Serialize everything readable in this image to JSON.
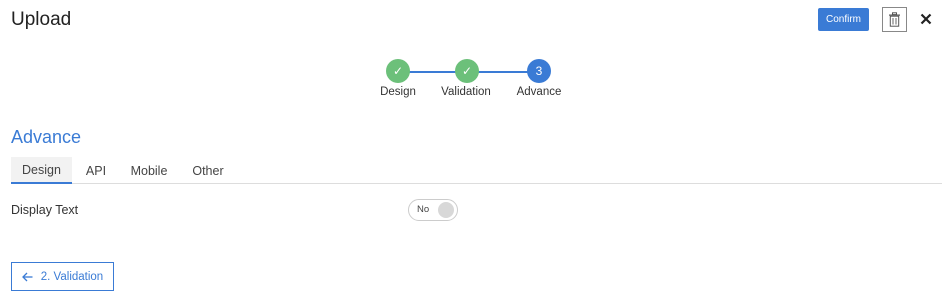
{
  "header": {
    "title": "Upload",
    "confirm_label": "Confirm"
  },
  "stepper": {
    "steps": [
      {
        "label": "Design",
        "status": "done",
        "marker": "✓"
      },
      {
        "label": "Validation",
        "status": "done",
        "marker": "✓"
      },
      {
        "label": "Advance",
        "status": "active",
        "marker": "3"
      }
    ]
  },
  "section": {
    "title": "Advance",
    "tabs": [
      {
        "label": "Design",
        "active": true
      },
      {
        "label": "API",
        "active": false
      },
      {
        "label": "Mobile",
        "active": false
      },
      {
        "label": "Other",
        "active": false
      }
    ]
  },
  "fields": {
    "display_text": {
      "label": "Display Text",
      "toggle_text": "No",
      "enabled": false
    }
  },
  "footer": {
    "back_label": "2. Validation"
  },
  "colors": {
    "accent": "#3a7bd5",
    "done": "#6cc07a"
  }
}
